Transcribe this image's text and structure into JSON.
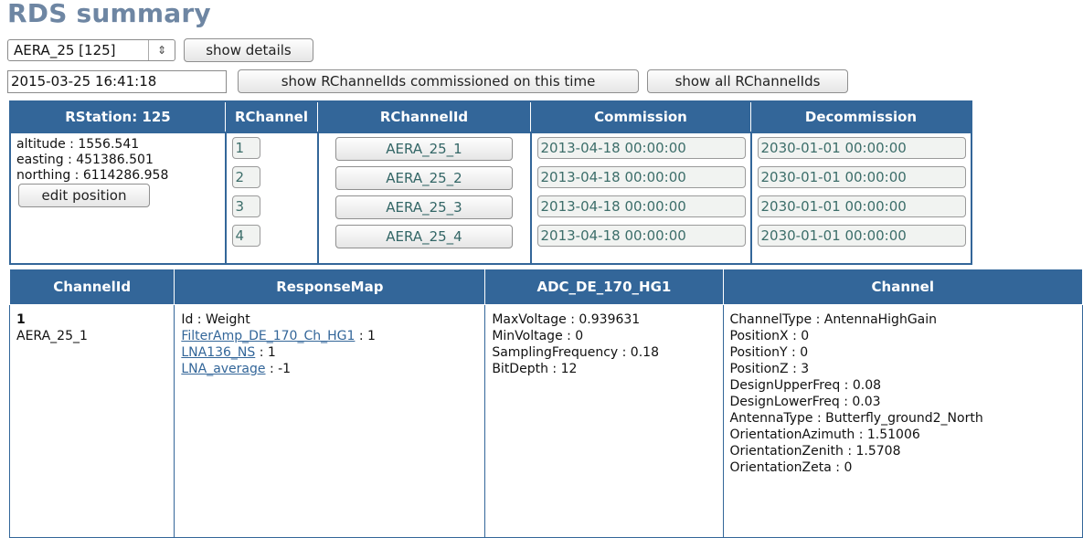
{
  "title": "RDS summary",
  "station_select": {
    "value": "AERA_25 [125]",
    "arrow_icon": "updown-chevron-icon"
  },
  "show_details_label": "show details",
  "datetime_input": {
    "value": "2015-03-25 16:41:18"
  },
  "show_commissioned_label": "show RChannelIds commissioned on this time",
  "show_all_label": "show all RChannelIds",
  "rstation_table": {
    "headers": [
      "RStation: 125",
      "RChannel",
      "RChannelId",
      "Commission",
      "Decommission"
    ],
    "station_info": [
      "altitude : 1556.541",
      "easting : 451386.501",
      "northing : 6114286.958"
    ],
    "edit_position_label": "edit position",
    "rows": [
      {
        "rchannel": "1",
        "rchannelid": "AERA_25_1",
        "commission": "2013-04-18 00:00:00",
        "decommission": "2030-01-01 00:00:00"
      },
      {
        "rchannel": "2",
        "rchannelid": "AERA_25_2",
        "commission": "2013-04-18 00:00:00",
        "decommission": "2030-01-01 00:00:00"
      },
      {
        "rchannel": "3",
        "rchannelid": "AERA_25_3",
        "commission": "2013-04-18 00:00:00",
        "decommission": "2030-01-01 00:00:00"
      },
      {
        "rchannel": "4",
        "rchannelid": "AERA_25_4",
        "commission": "2013-04-18 00:00:00",
        "decommission": "2030-01-01 00:00:00"
      }
    ]
  },
  "channel_table": {
    "headers": [
      "ChannelId",
      "ResponseMap",
      "ADC_DE_170_HG1",
      "Channel"
    ],
    "channelid": {
      "number": "1",
      "name": "AERA_25_1"
    },
    "responsemap": {
      "heading": "Id : Weight",
      "entries": [
        {
          "link": "FilterAmp_DE_170_Ch_HG1",
          "weight": " : 1"
        },
        {
          "link": "LNA136_NS",
          "weight": " : 1"
        },
        {
          "link": "LNA_average",
          "weight": " : -1"
        }
      ]
    },
    "adc": [
      "MaxVoltage : 0.939631",
      "MinVoltage : 0",
      "SamplingFrequency : 0.18",
      "BitDepth : 12"
    ],
    "channel": [
      "ChannelType : AntennaHighGain",
      "PositionX : 0",
      "PositionY : 0",
      "PositionZ : 3",
      "DesignUpperFreq : 0.08",
      "DesignLowerFreq : 0.03",
      "AntennaType : Butterfly_ground2_North",
      "OrientationAzimuth : 1.51006",
      "OrientationZenith : 1.5708",
      "OrientationZeta : 0"
    ]
  }
}
